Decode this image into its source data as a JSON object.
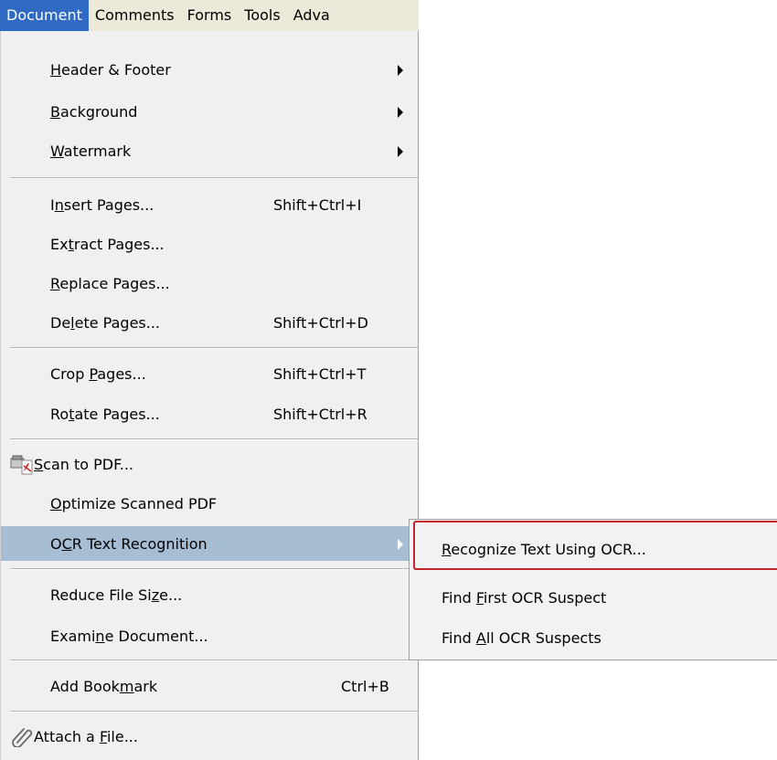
{
  "menubar": {
    "items": [
      {
        "label": "Document"
      },
      {
        "label": "Comments"
      },
      {
        "label": "Forms"
      },
      {
        "label": "Tools"
      },
      {
        "label": "Adva"
      }
    ]
  },
  "document_menu": {
    "header_footer": {
      "pre": "",
      "key": "H",
      "post": "eader & Footer"
    },
    "background": {
      "pre": "",
      "key": "B",
      "post": "ackground"
    },
    "watermark": {
      "pre": "",
      "key": "W",
      "post": "atermark"
    },
    "insert_pages": {
      "pre": "I",
      "key": "n",
      "post": "sert Pages...",
      "shortcut": "Shift+Ctrl+I"
    },
    "extract_pages": {
      "pre": "Ex",
      "key": "t",
      "post": "ract Pages..."
    },
    "replace_pages": {
      "pre": "",
      "key": "R",
      "post": "eplace Pages..."
    },
    "delete_pages": {
      "pre": "De",
      "key": "l",
      "post": "ete Pages...",
      "shortcut": "Shift+Ctrl+D"
    },
    "crop_pages": {
      "pre": "Crop ",
      "key": "P",
      "post": "ages...",
      "shortcut": "Shift+Ctrl+T"
    },
    "rotate_pages": {
      "pre": "Ro",
      "key": "t",
      "post": "ate Pages...",
      "shortcut": "Shift+Ctrl+R"
    },
    "scan_to_pdf": {
      "pre": "",
      "key": "S",
      "post": "can to PDF..."
    },
    "optimize_scanned": {
      "pre": "",
      "key": "O",
      "post": "ptimize Scanned PDF"
    },
    "ocr_text_recognition": {
      "pre": "O",
      "key": "C",
      "post": "R Text Recognition"
    },
    "reduce_file_size": {
      "pre": "Reduce File Si",
      "key": "z",
      "post": "e..."
    },
    "examine_document": {
      "pre": "Exami",
      "key": "n",
      "post": "e Document..."
    },
    "add_bookmark": {
      "pre": "Add Book",
      "key": "m",
      "post": "ark",
      "shortcut": "Ctrl+B"
    },
    "attach_file": {
      "pre": "Attach a ",
      "key": "F",
      "post": "ile..."
    }
  },
  "ocr_submenu": {
    "recognize": {
      "pre": "",
      "key": "R",
      "post": "ecognize Text Using OCR..."
    },
    "find_first": {
      "pre": "Find ",
      "key": "F",
      "post": "irst OCR Suspect"
    },
    "find_all": {
      "pre": "Find ",
      "key": "A",
      "post": "ll OCR Suspects"
    }
  },
  "colors": {
    "menubar_active": "#316ac5",
    "menu_highlight": "#a7bdd3",
    "focus_ring": "#c4252f",
    "menu_background": "#f0f0f0"
  }
}
